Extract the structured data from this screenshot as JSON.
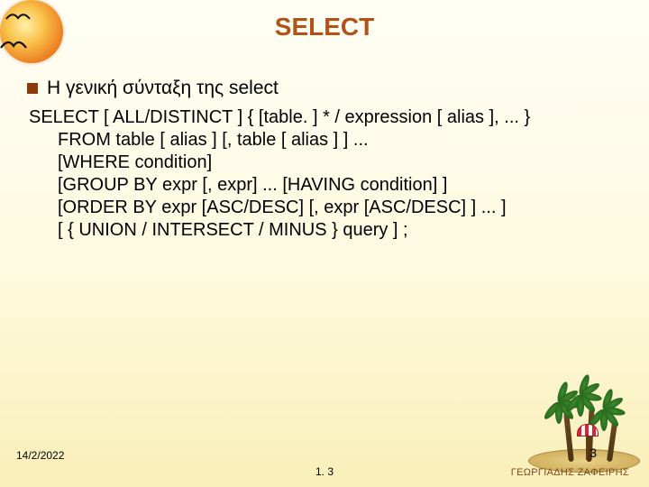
{
  "title": "SELECT",
  "bullet": "Η γενική σύνταξη της select",
  "syntax": {
    "line1": "SELECT [ ALL/DISTINCT ] { [table. ] * / expression [ alias ], ... }",
    "line2": "FROM table [ alias ] [, table [ alias ] ] ...",
    "line3": "[WHERE condition]",
    "line4": "[GROUP BY expr [, expr] ... [HAVING condition] ]",
    "line5": "[ORDER BY expr [ASC/DESC] [, expr [ASC/DESC] ] ... ]",
    "line6": "[ { UNION / INTERSECT / MINUS } query ] ;"
  },
  "footer": {
    "date": "14/2/2022",
    "subnum": "1. 3",
    "pagenum": "3",
    "author": "ΓΕΩΡΓΙΑΔΗΣ ΖΑΦΕΙΡΗΣ"
  }
}
